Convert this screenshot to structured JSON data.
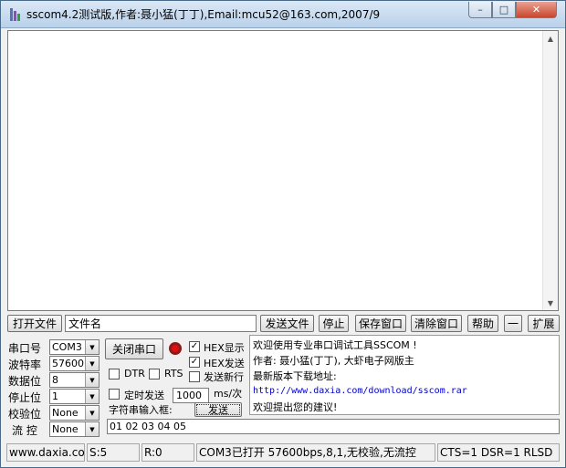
{
  "window": {
    "title": "sscom4.2测试版,作者:聂小猛(丁丁),Email:mcu52@163.com,2007/9",
    "min_symbol": "–",
    "max_symbol": "□",
    "close_symbol": "✕"
  },
  "toolbar": {
    "open_file": "打开文件",
    "file_name": "文件名",
    "send_file": "发送文件",
    "stop": "停止",
    "save_window": "保存窗口",
    "clear_window": "清除窗口",
    "help": "帮助",
    "dash": "一",
    "expand": "扩展"
  },
  "settings": {
    "port": {
      "label": "串口号",
      "value": "COM3"
    },
    "baud": {
      "label": "波特率",
      "value": "57600"
    },
    "data_bits": {
      "label": "数据位",
      "value": "8"
    },
    "stop_bits": {
      "label": "停止位",
      "value": "1"
    },
    "parity": {
      "label": "校验位",
      "value": "None"
    },
    "flow": {
      "label": "流 控",
      "value": "None"
    }
  },
  "controls": {
    "close_port": "关闭串口",
    "hex_display": "HEX显示",
    "hex_send": "HEX发送",
    "dtr": "DTR",
    "rts": "RTS",
    "send_newline": "发送新行",
    "timed_send": "定时发送",
    "interval": "1000",
    "interval_unit": "ms/次",
    "input_label": "字符串输入框:",
    "send": "发送",
    "send_text": "01 02 03 04 05",
    "hex_display_checked": "✓",
    "hex_send_checked": "✓"
  },
  "info": {
    "line1": "欢迎使用专业串口调试工具SSCOM !",
    "line2": "作者: 聂小猛(丁丁), 大虾电子网版主",
    "line3": "最新版本下载地址:",
    "line4": "http://www.daxia.com/download/sscom.rar",
    "line5": "欢迎提出您的建议!"
  },
  "status": {
    "site": "www.daxia.com",
    "sent": "S:5",
    "received": "R:0",
    "port_state": "COM3已打开  57600bps,8,1,无校验,无流控",
    "lines": "CTS=1 DSR=1 RLSD"
  },
  "colors": {
    "record_outer": "#8b1a1a",
    "record_inner": "#e01010",
    "link": "#0000cc"
  }
}
